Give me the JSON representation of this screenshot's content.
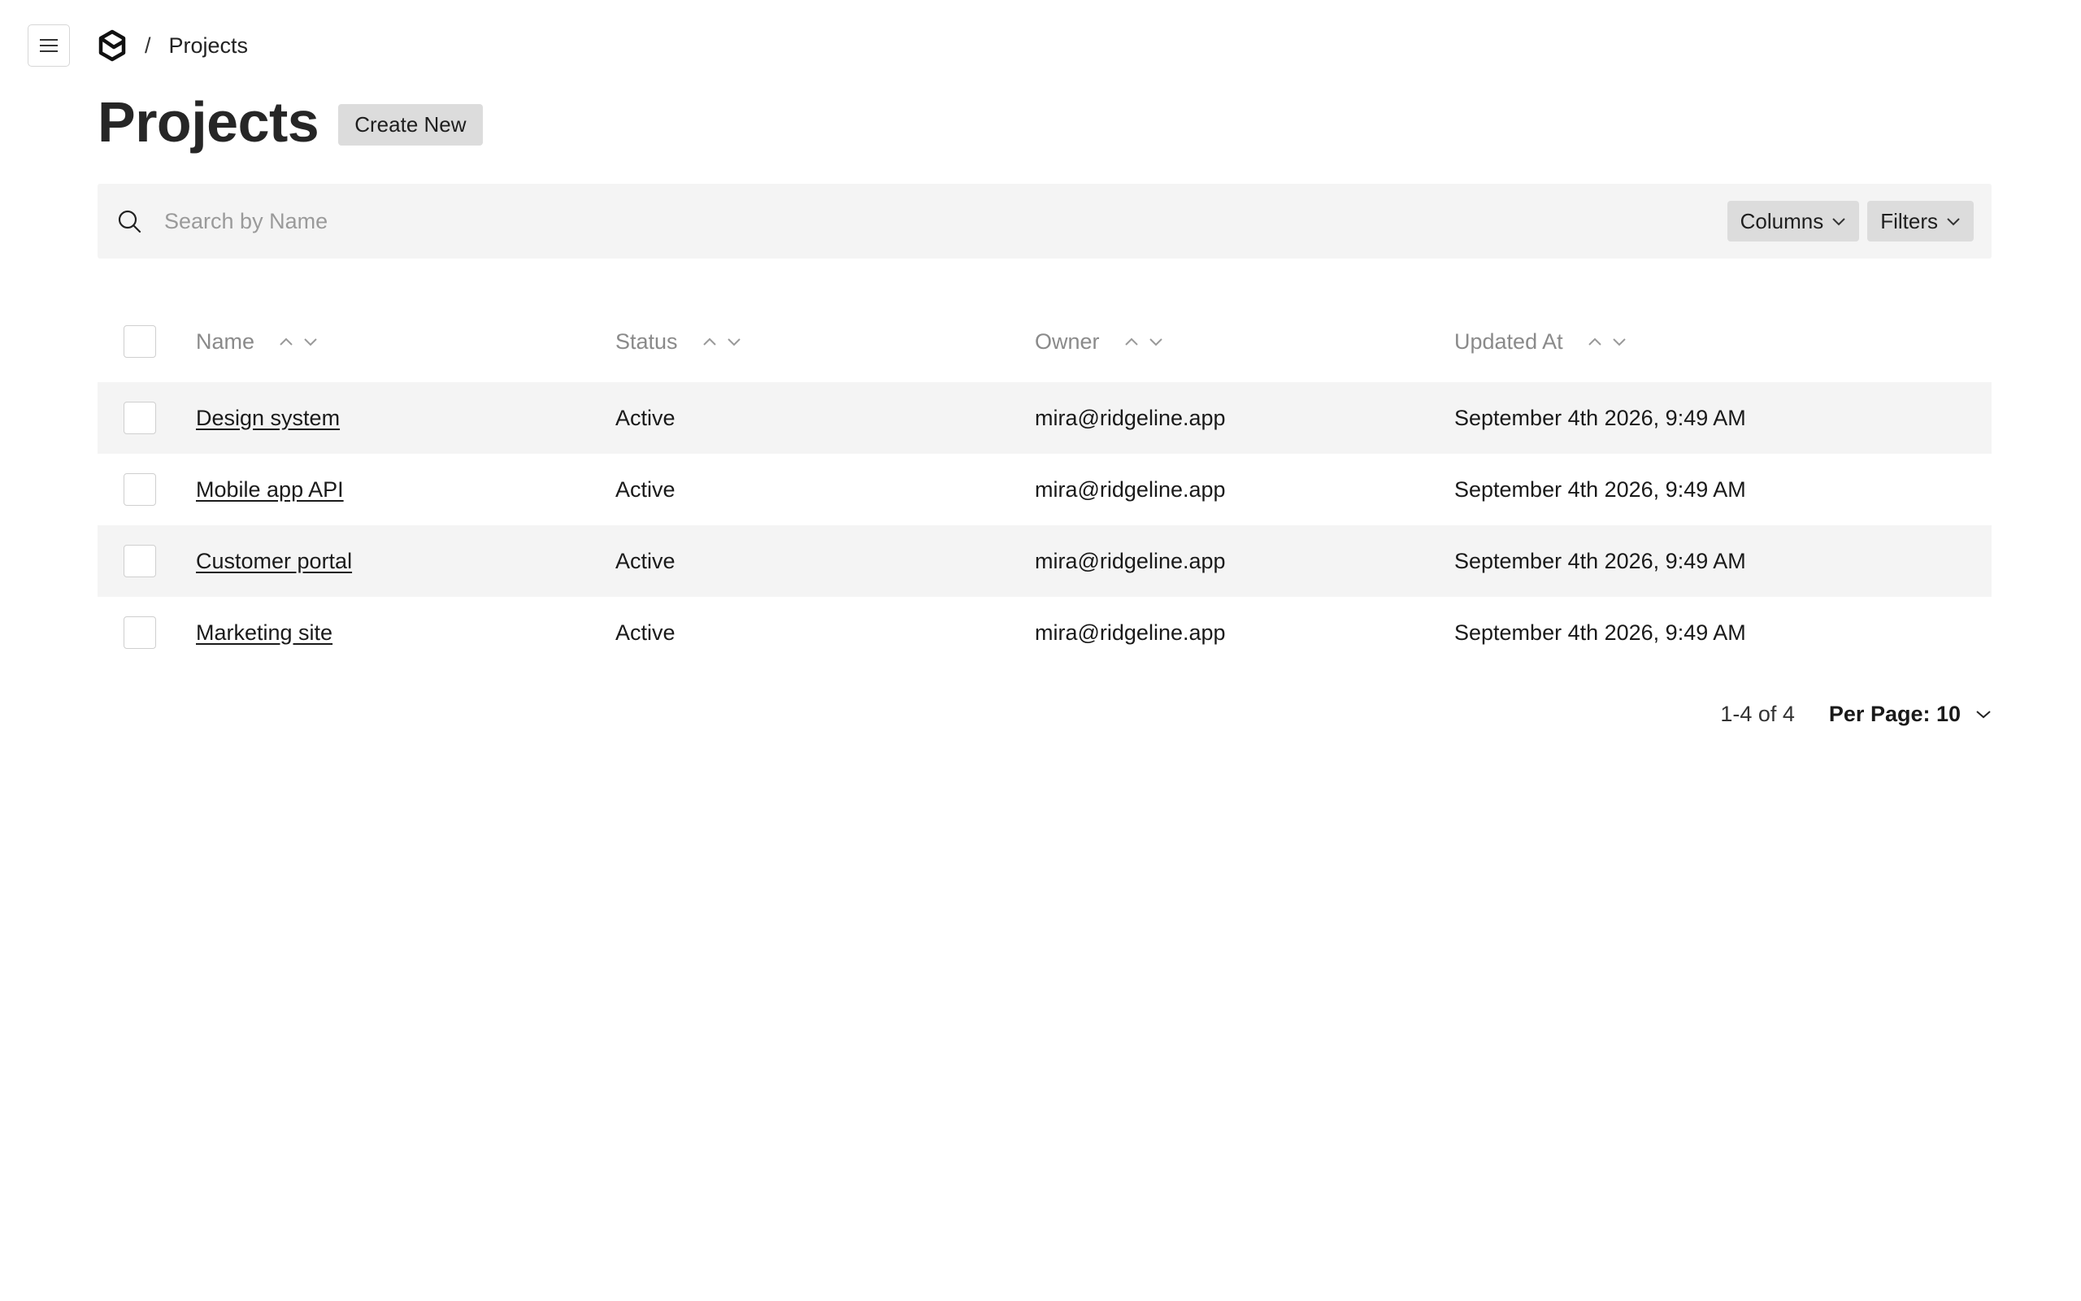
{
  "breadcrumb": {
    "current": "Projects",
    "separator": "/"
  },
  "header": {
    "title": "Projects",
    "create_label": "Create New"
  },
  "toolbar": {
    "search_placeholder": "Search by Name",
    "columns_label": "Columns",
    "filters_label": "Filters"
  },
  "table": {
    "headers": {
      "name": "Name",
      "status": "Status",
      "owner": "Owner",
      "updated": "Updated At"
    },
    "rows": [
      {
        "name": "Design system",
        "status": "Active",
        "owner": "mira@ridgeline.app",
        "updated": "September 4th 2026, 9:49 AM"
      },
      {
        "name": "Mobile app API",
        "status": "Active",
        "owner": "mira@ridgeline.app",
        "updated": "September 4th 2026, 9:49 AM"
      },
      {
        "name": "Customer portal",
        "status": "Active",
        "owner": "mira@ridgeline.app",
        "updated": "September 4th 2026, 9:49 AM"
      },
      {
        "name": "Marketing site",
        "status": "Active",
        "owner": "mira@ridgeline.app",
        "updated": "September 4th 2026, 9:49 AM"
      }
    ]
  },
  "pagination": {
    "range": "1-4 of 4",
    "per_page": "Per Page: 10"
  },
  "colors": {
    "stripe": "#f4f4f4",
    "button": "#dcdcdc",
    "muted_text": "#8a8a8a"
  }
}
